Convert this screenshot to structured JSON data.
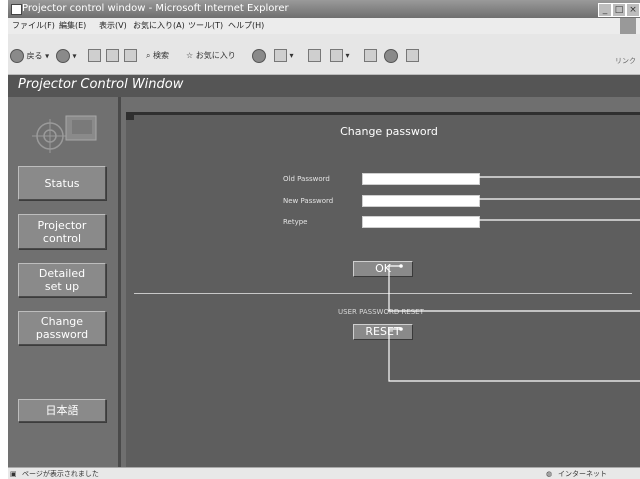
{
  "window": {
    "title": "Projector control window - Microsoft Internet Explorer"
  },
  "menu": [
    "ファイル(F)",
    "編集(E)",
    "表示(V)",
    "お気に入り(A)",
    "ツール(T)",
    "ヘルプ(H)"
  ],
  "toolbar": {
    "back_label": "戻る",
    "search_label": "検索",
    "favorites_label": "お気に入り",
    "links_label": "リンク"
  },
  "app": {
    "header": "Projector Control Window"
  },
  "sidebar": {
    "items": [
      {
        "label": "Status"
      },
      {
        "label": "Projector\ncontrol"
      },
      {
        "label": "Detailed\nset up"
      },
      {
        "label": "Change\npassword"
      },
      {
        "label": "日本語"
      }
    ]
  },
  "main": {
    "title": "Change password",
    "fields": [
      {
        "label": "Old Password",
        "value": ""
      },
      {
        "label": "New Password",
        "value": ""
      },
      {
        "label": "Retype",
        "value": ""
      }
    ],
    "ok_label": "OK",
    "reset_section_label": "USER PASSWORD RESET",
    "reset_label": "RESET"
  },
  "status": {
    "left": "ページが表示されました",
    "zone": "インターネット"
  },
  "colors": {
    "content_bg": "#5e5e5e",
    "sidebar_bg": "#707070",
    "button_bg": "#8a8a8a"
  }
}
